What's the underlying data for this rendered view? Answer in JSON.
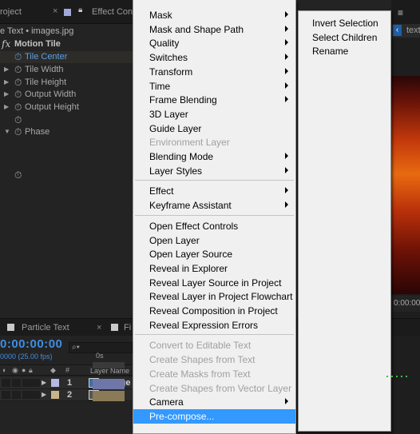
{
  "effect_controls": {
    "tab_project": "roject",
    "tab_effect_controls": "Effect Cont",
    "subtitle": "e Text • images.jpg",
    "effect_name": "Motion Tile",
    "properties": [
      {
        "label": "Tile Center",
        "twirl": "",
        "highlight": true,
        "blue": true
      },
      {
        "label": "Tile Width",
        "twirl": "▶",
        "highlight": false,
        "blue": false
      },
      {
        "label": "Tile Height",
        "twirl": "▶",
        "highlight": false,
        "blue": false
      },
      {
        "label": "Output Width",
        "twirl": "▶",
        "highlight": false,
        "blue": false
      },
      {
        "label": "Output Height",
        "twirl": "▶",
        "highlight": false,
        "blue": false
      },
      {
        "label": "",
        "twirl": "",
        "highlight": false,
        "blue": false
      },
      {
        "label": "Phase",
        "twirl": "▼",
        "highlight": false,
        "blue": false
      },
      {
        "label": "",
        "twirl": "",
        "highlight": false,
        "blue": false
      }
    ]
  },
  "viewer": {
    "tab_label": "text",
    "timecode": "0:00:00"
  },
  "timeline": {
    "tab_label": "Particle Text",
    "tab_label_2": "Fi",
    "timecode": "0:00:00:00",
    "fps": "0000 (25.00 fps)",
    "search_placeholder": "",
    "col_hash": "#",
    "col_layer_name": "Layer Name",
    "ruler_label": "0s",
    "layers": [
      {
        "num": "1",
        "name": "[image",
        "color": "#b6b7e3",
        "type": "footage"
      },
      {
        "num": "2",
        "name": "[text]",
        "color": "#c8b48a",
        "type": "comp"
      }
    ]
  },
  "context_menu": {
    "items": [
      {
        "label": "Mask",
        "submenu": true,
        "disabled": false
      },
      {
        "label": "Mask and Shape Path",
        "submenu": true,
        "disabled": false
      },
      {
        "label": "Quality",
        "submenu": true,
        "disabled": false
      },
      {
        "label": "Switches",
        "submenu": true,
        "disabled": false
      },
      {
        "label": "Transform",
        "submenu": true,
        "disabled": false
      },
      {
        "label": "Time",
        "submenu": true,
        "disabled": false
      },
      {
        "label": "Frame Blending",
        "submenu": true,
        "disabled": false
      },
      {
        "label": "3D Layer",
        "submenu": false,
        "disabled": false
      },
      {
        "label": "Guide Layer",
        "submenu": false,
        "disabled": false
      },
      {
        "label": "Environment Layer",
        "submenu": false,
        "disabled": true
      },
      {
        "label": "Blending Mode",
        "submenu": true,
        "disabled": false
      },
      {
        "label": "Layer Styles",
        "submenu": true,
        "disabled": false
      },
      {
        "separator": true
      },
      {
        "label": "Effect",
        "submenu": true,
        "disabled": false
      },
      {
        "label": "Keyframe Assistant",
        "submenu": true,
        "disabled": false
      },
      {
        "separator": true
      },
      {
        "label": "Open Effect Controls",
        "submenu": false,
        "disabled": false
      },
      {
        "label": "Open Layer",
        "submenu": false,
        "disabled": false
      },
      {
        "label": "Open Layer Source",
        "submenu": false,
        "disabled": false
      },
      {
        "label": "Reveal in Explorer",
        "submenu": false,
        "disabled": false
      },
      {
        "label": "Reveal Layer Source in Project",
        "submenu": false,
        "disabled": false
      },
      {
        "label": "Reveal Layer in Project Flowchart",
        "submenu": false,
        "disabled": false
      },
      {
        "label": "Reveal Composition in Project",
        "submenu": false,
        "disabled": false
      },
      {
        "label": "Reveal Expression Errors",
        "submenu": false,
        "disabled": false
      },
      {
        "separator": true
      },
      {
        "label": "Convert to Editable Text",
        "submenu": false,
        "disabled": true
      },
      {
        "label": "Create Shapes from Text",
        "submenu": false,
        "disabled": true
      },
      {
        "label": "Create Masks from Text",
        "submenu": false,
        "disabled": true
      },
      {
        "label": "Create Shapes from Vector Layer",
        "submenu": false,
        "disabled": true
      },
      {
        "label": "Camera",
        "submenu": true,
        "disabled": false
      },
      {
        "label": "Pre-compose...",
        "submenu": false,
        "disabled": false,
        "highlighted": true
      }
    ]
  },
  "sub_menu": {
    "items": [
      {
        "label": "Invert Selection"
      },
      {
        "label": "Select Children"
      },
      {
        "label": "Rename"
      }
    ]
  },
  "colors": {
    "menu_bg": "#f0f0f0",
    "menu_highlight": "#3399ff",
    "ae_blue": "#3f8ee0",
    "panel_bg": "#232323"
  }
}
